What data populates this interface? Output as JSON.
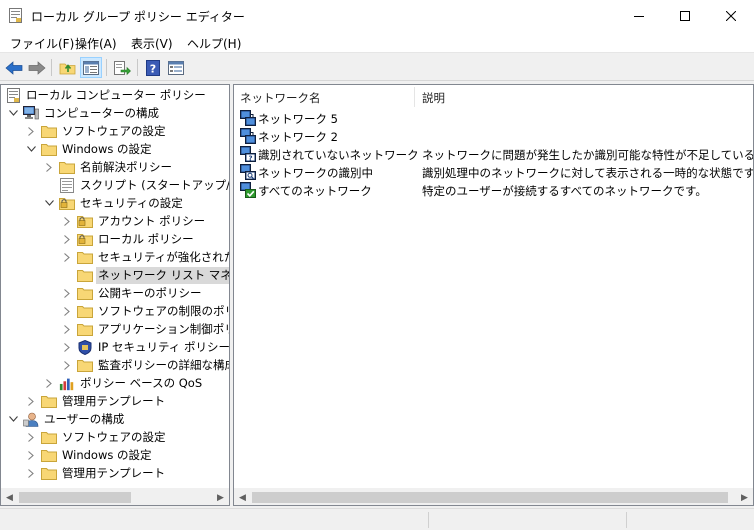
{
  "window": {
    "title": "ローカル グループ ポリシー エディター",
    "buttons": {
      "minimize": "minimize",
      "maximize": "maximize",
      "close": "close"
    }
  },
  "menu": [
    {
      "label": "ファイル(F)"
    },
    {
      "label": "操作(A)"
    },
    {
      "label": "表示(V)"
    },
    {
      "label": "ヘルプ(H)"
    }
  ],
  "toolbar": {
    "buttons": [
      "back-arrow-icon",
      "forward-arrow-icon",
      "up-folder-icon",
      "show-hide-tree-icon",
      "export-list-icon",
      "help-icon",
      "properties-view-icon"
    ]
  },
  "tree": {
    "items": [
      {
        "label": "ローカル コンピューター ポリシー",
        "icon": "policy-document-icon",
        "expander": "none"
      },
      {
        "label": "コンピューターの構成",
        "icon": "computer-icon",
        "expander": "expanded"
      },
      {
        "label": "ソフトウェアの設定",
        "icon": "folder-icon",
        "expander": "collapsed"
      },
      {
        "label": "Windows の設定",
        "icon": "folder-icon",
        "expander": "expanded"
      },
      {
        "label": "名前解決ポリシー",
        "icon": "folder-icon",
        "expander": "collapsed"
      },
      {
        "label": "スクリプト (スタートアップ/シャット",
        "icon": "script-icon",
        "expander": "none"
      },
      {
        "label": "セキュリティの設定",
        "icon": "security-folder-icon",
        "expander": "expanded"
      },
      {
        "label": "アカウント ポリシー",
        "icon": "security-folder-icon",
        "expander": "collapsed"
      },
      {
        "label": "ローカル ポリシー",
        "icon": "security-folder-icon",
        "expander": "collapsed"
      },
      {
        "label": "セキュリティが強化された W",
        "icon": "folder-icon",
        "expander": "collapsed"
      },
      {
        "label": "ネットワーク リスト マネージャ",
        "icon": "folder-icon",
        "expander": "none",
        "selected": true
      },
      {
        "label": "公開キーのポリシー",
        "icon": "folder-icon",
        "expander": "collapsed"
      },
      {
        "label": "ソフトウェアの制限のポリシー",
        "icon": "folder-icon",
        "expander": "collapsed"
      },
      {
        "label": "アプリケーション制御ポリシー",
        "icon": "folder-icon",
        "expander": "collapsed"
      },
      {
        "label": "IP セキュリティ ポリシー (ロー",
        "icon": "ip-security-icon",
        "expander": "collapsed"
      },
      {
        "label": "監査ポリシーの詳細な構成",
        "icon": "folder-icon",
        "expander": "collapsed"
      },
      {
        "label": "ポリシー ベースの QoS",
        "icon": "qos-chart-icon",
        "expander": "collapsed"
      },
      {
        "label": "管理用テンプレート",
        "icon": "folder-icon",
        "expander": "collapsed"
      },
      {
        "label": "ユーザーの構成",
        "icon": "user-icon",
        "expander": "expanded"
      },
      {
        "label": "ソフトウェアの設定",
        "icon": "folder-icon",
        "expander": "collapsed"
      },
      {
        "label": "Windows の設定",
        "icon": "folder-icon",
        "expander": "collapsed"
      },
      {
        "label": "管理用テンプレート",
        "icon": "folder-icon",
        "expander": "collapsed"
      }
    ]
  },
  "list": {
    "columns": [
      "ネットワーク名",
      "説明"
    ],
    "rows": [
      {
        "name": "ネットワーク 5",
        "description": "",
        "icon": "network-icon"
      },
      {
        "name": "ネットワーク 2",
        "description": "",
        "icon": "network-icon"
      },
      {
        "name": "識別されていないネットワーク",
        "description": "ネットワークに問題が発生したか識別可能な特性が不足していることが原",
        "icon": "unidentified-network-icon"
      },
      {
        "name": "ネットワークの識別中",
        "description": "識別処理中のネットワークに対して表示される一時的な状態です。",
        "icon": "identifying-network-icon"
      },
      {
        "name": "すべてのネットワーク",
        "description": "特定のユーザーが接続するすべてのネットワークです。",
        "icon": "all-networks-icon"
      }
    ]
  },
  "colors": {
    "selection": "#d9d9d9",
    "pane_border": "#828790",
    "folder": "#f8d775",
    "toolbar_pressed": "#cce8ff",
    "back_arrow": "#2a6fc9"
  }
}
